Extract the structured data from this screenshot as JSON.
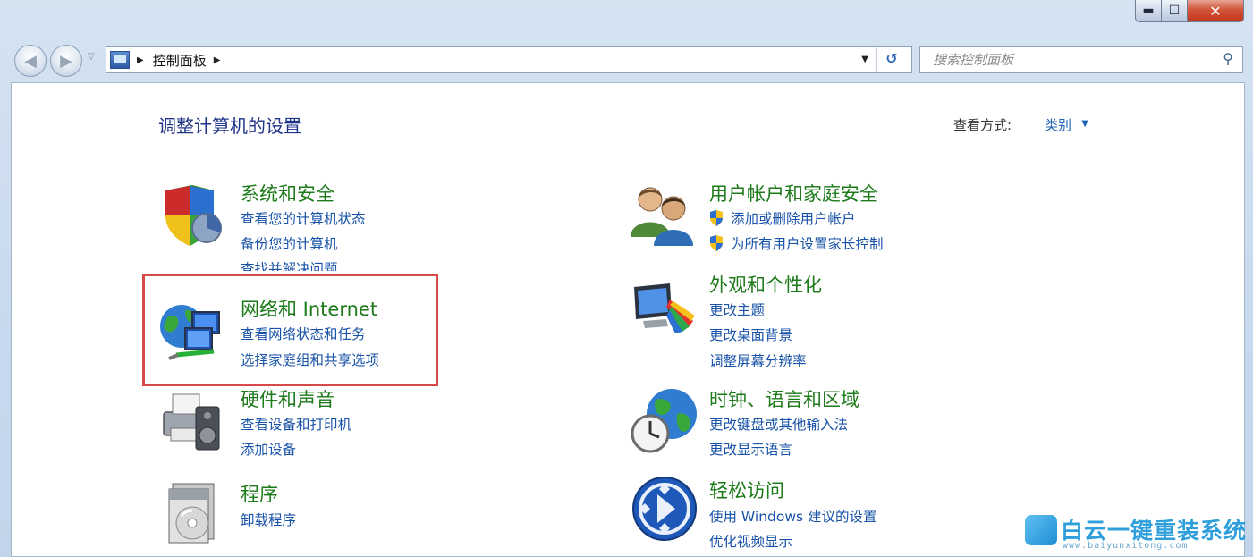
{
  "window": {
    "min_glyph": "▬",
    "max_glyph": "☐",
    "close_glyph": "✕"
  },
  "nav": {
    "back_glyph": "◀",
    "forward_glyph": "▶",
    "history_glyph": "▽",
    "address": {
      "separator": "▶",
      "crumb": "控制面板",
      "crumb_separator": "▶",
      "dropdown_glyph": "▼"
    },
    "refresh_glyph": "↺",
    "search": {
      "placeholder": "搜索控制面板",
      "icon_glyph": "⚲"
    }
  },
  "main": {
    "title": "调整计算机的设置",
    "view_by_label": "查看方式:",
    "view_by_value": "类别",
    "view_by_caret": "▼",
    "categories": [
      {
        "heading": "系统和安全",
        "icon": "shield-security-icon",
        "links": [
          "查看您的计算机状态",
          "备份您的计算机",
          "查找并解决问题"
        ]
      },
      {
        "heading": "网络和 Internet",
        "icon": "network-globe-icon",
        "links": [
          "查看网络状态和任务",
          "选择家庭组和共享选项"
        ]
      },
      {
        "heading": "硬件和声音",
        "icon": "printer-speaker-icon",
        "links": [
          "查看设备和打印机",
          "添加设备"
        ]
      },
      {
        "heading": "程序",
        "icon": "programs-disc-icon",
        "links": [
          "卸载程序"
        ]
      },
      {
        "heading": "用户帐户和家庭安全",
        "icon": "users-icon",
        "links": [
          "添加或删除用户帐户",
          "为所有用户设置家长控制"
        ]
      },
      {
        "heading": "外观和个性化",
        "icon": "monitor-paint-icon",
        "links": [
          "更改主题",
          "更改桌面背景",
          "调整屏幕分辨率"
        ]
      },
      {
        "heading": "时钟、语言和区域",
        "icon": "clock-globe-icon",
        "links": [
          "更改键盘或其他输入法",
          "更改显示语言"
        ]
      },
      {
        "heading": "轻松访问",
        "icon": "ease-of-access-icon",
        "links": [
          "使用 Windows 建议的设置",
          "优化视频显示"
        ]
      }
    ]
  },
  "watermark": {
    "brand": "白云一键重装系统",
    "url": "www.baiyunxitong.com"
  },
  "colors": {
    "heading_green": "#1c7a19",
    "link_blue": "#1853a9",
    "title_blue": "#1e3287",
    "highlight_red": "#d84a4a"
  }
}
